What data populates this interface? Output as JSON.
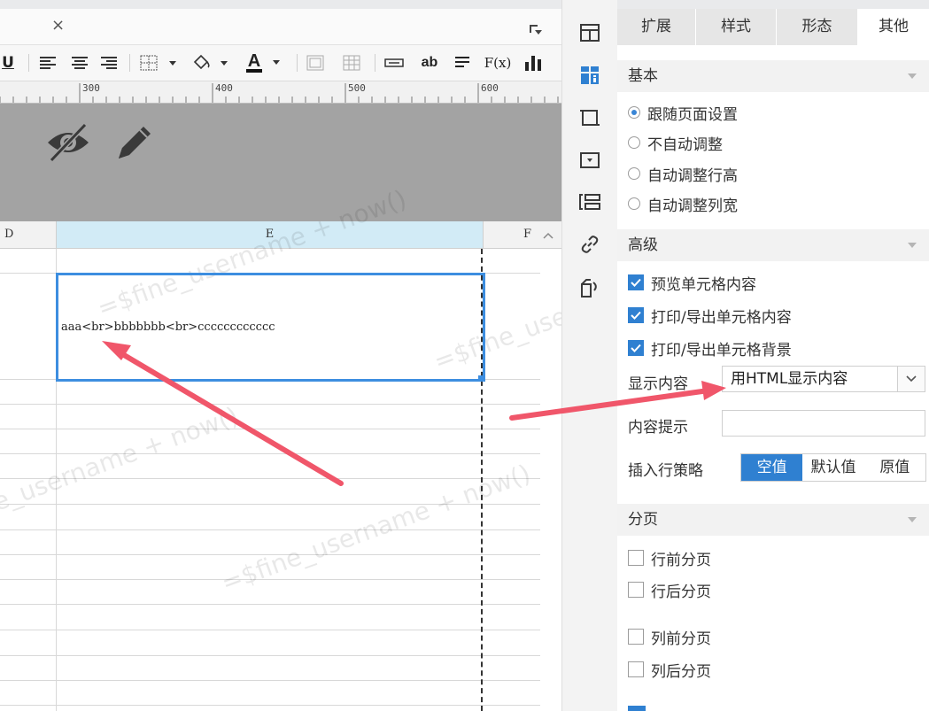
{
  "editor": {
    "tab_close_glyph": "×",
    "toolbar": {
      "underline_label": "U",
      "ab_label": "ab",
      "fx_label": "F(x)",
      "font_color_label": "A"
    },
    "ruler": {
      "labels": [
        "300",
        "400",
        "500",
        "600"
      ]
    },
    "columns": {
      "d": "D",
      "e": "E",
      "f": "F"
    },
    "cell": {
      "content": "aaa<br>bbbbbbb<br>cccccccccccc"
    },
    "watermark": "=$fine_username + now()",
    "colors": {
      "selection": "#3d8ee0",
      "arrow": "#f0566a",
      "header_highlight": "#d2ebf6"
    }
  },
  "iconcol": {
    "icons": [
      "cell-element-icon",
      "cell-attribute-icon",
      "frame-icon",
      "widget-icon",
      "condition-attribute-icon",
      "hyperlink-icon",
      "cell-expand-icon"
    ]
  },
  "panel": {
    "tabs": [
      "扩展",
      "样式",
      "形态",
      "其他"
    ],
    "active_tab": "其他",
    "basic": {
      "title": "基本",
      "options": [
        "跟随页面设置",
        "不自动调整",
        "自动调整行高",
        "自动调整列宽"
      ],
      "selected": "跟随页面设置"
    },
    "advanced": {
      "title": "高级",
      "checks": [
        "预览单元格内容",
        "打印/导出单元格内容",
        "打印/导出单元格背景"
      ],
      "display_label": "显示内容",
      "display_value": "用HTML显示内容",
      "hint_label": "内容提示",
      "hint_value": "",
      "insert_label": "插入行策略",
      "insert_options": [
        "空值",
        "默认值",
        "原值"
      ],
      "insert_selected": "空值"
    },
    "pagination": {
      "title": "分页",
      "checks": [
        "行前分页",
        "行后分页",
        "列前分页",
        "列后分页"
      ]
    }
  }
}
